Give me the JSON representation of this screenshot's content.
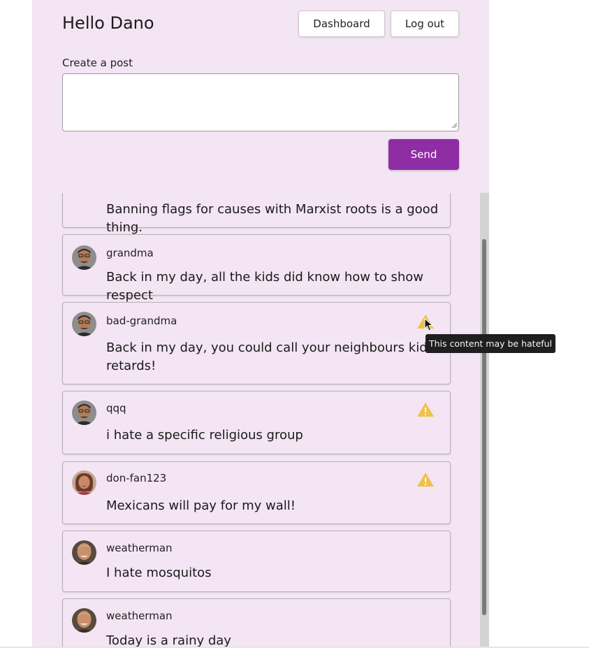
{
  "header": {
    "greeting": "Hello Dano",
    "dashboard_label": "Dashboard",
    "logout_label": "Log out"
  },
  "composer": {
    "label": "Create a post",
    "value": "",
    "placeholder": "",
    "send_label": "Send"
  },
  "feed": {
    "partial_post_text": "Banning flags for causes with Marxist roots is a good thing.",
    "posts": [
      {
        "username": "grandma",
        "content": "Back in my day, all the kids did know how to show respect",
        "flagged": false,
        "avatar": "man-glasses"
      },
      {
        "username": "bad-grandma",
        "content": "Back in my day, you could call your neighbours kids retards!",
        "flagged": true,
        "avatar": "man-glasses"
      },
      {
        "username": "qqq",
        "content": "i hate a specific religious group",
        "flagged": true,
        "avatar": "man-glasses"
      },
      {
        "username": "don-fan123",
        "content": "Mexicans will pay for my wall!",
        "flagged": true,
        "avatar": "woman"
      },
      {
        "username": "weatherman",
        "content": "I hate mosquitos",
        "flagged": false,
        "avatar": "older-man"
      },
      {
        "username": "weatherman",
        "content": "Today is a rainy day",
        "flagged": false,
        "avatar": "older-man"
      }
    ]
  },
  "tooltip": {
    "text": "This content may be hateful"
  },
  "colors": {
    "background": "#f3e5f3",
    "accent": "#8e2da4",
    "warning": "#f0c14b",
    "tooltip_bg": "#1f1f1f"
  },
  "icons": {
    "warning": "warning-triangle-icon",
    "cursor": "mouse-pointer-icon"
  }
}
